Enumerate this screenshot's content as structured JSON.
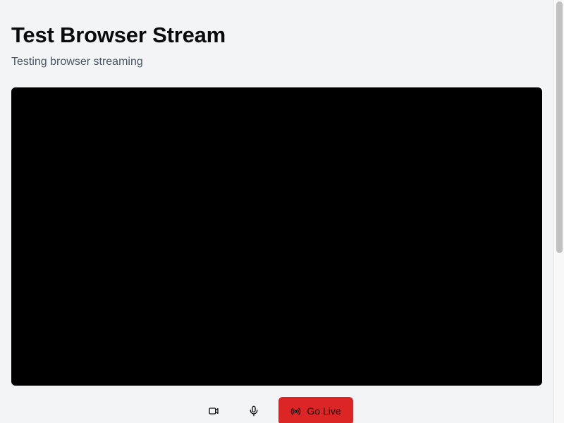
{
  "page": {
    "title": "Test Browser Stream",
    "subtitle": "Testing browser streaming"
  },
  "controls": {
    "camera_icon": "video-camera-icon",
    "mic_icon": "microphone-icon",
    "go_live_icon": "radio-broadcast-icon",
    "go_live_label": "Go Live",
    "go_live_color": "#dc2626"
  },
  "colors": {
    "background": "#f3f4f6",
    "video_background": "#000000",
    "subtitle": "#4b5563"
  }
}
